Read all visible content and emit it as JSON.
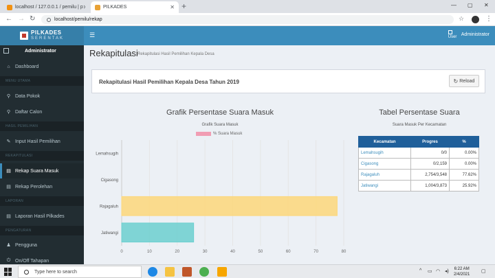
{
  "browser": {
    "tabs": [
      {
        "title": "localhost / 127.0.0.1 / pemilu | p",
        "favicon_color": "#f29111"
      },
      {
        "title": "PILKADES",
        "favicon_color": "#e8a236"
      }
    ],
    "url": "localhost/pemilu/rekap"
  },
  "app": {
    "logo_line1": "PILKADES",
    "logo_line2": "SERENTAK",
    "user_pic_alt": "User",
    "user_name": "Administrator"
  },
  "sidebar": {
    "user_name": "Administrator",
    "items": [
      {
        "type": "item",
        "label": "Dashboard",
        "icon": "home-icon",
        "glyph": "⌂"
      },
      {
        "type": "header",
        "label": "MENU UTAMA"
      },
      {
        "type": "item",
        "label": "Data Pokok",
        "icon": "map-marker-icon",
        "glyph": "⚲"
      },
      {
        "type": "item",
        "label": "Daftar Calon",
        "icon": "map-marker-icon",
        "glyph": "⚲"
      },
      {
        "type": "header",
        "label": "HASIL PEMILIHAN"
      },
      {
        "type": "item",
        "label": "Input Hasil Pemilihan",
        "icon": "edit-icon",
        "glyph": "✎"
      },
      {
        "type": "header",
        "label": "REKAPITULASI"
      },
      {
        "type": "item",
        "label": "Rekap Suara Masuk",
        "icon": "report-icon",
        "glyph": "▤",
        "active": true
      },
      {
        "type": "item",
        "label": "Rekap Perolehan",
        "icon": "report-icon",
        "glyph": "▤"
      },
      {
        "type": "header",
        "label": "LAPORAN"
      },
      {
        "type": "item",
        "label": "Laporan Hasil Pilkades",
        "icon": "report-icon",
        "glyph": "▤"
      },
      {
        "type": "header",
        "label": "PENGATURAN"
      },
      {
        "type": "item",
        "label": "Pengguna",
        "icon": "users-icon",
        "glyph": "♟"
      },
      {
        "type": "item",
        "label": "On/Off Tahapan",
        "icon": "power-icon",
        "glyph": "⏻"
      }
    ]
  },
  "page": {
    "title": "Rekapitulasi",
    "subtitle": "Rekapitulasi Hasil Pemilihan Kepala Desa",
    "box_title": "Rekapitulasi Hasil Pemilihan Kepala Desa Tahun 2019",
    "reload_label": "Reload"
  },
  "chart_section": {
    "heading": "Grafik Persentase Suara Masuk"
  },
  "chart_data": {
    "type": "bar",
    "orientation": "horizontal",
    "title": "Grafik Suara Masuk",
    "categories": [
      "Lemahsugih",
      "Cigasong",
      "Rajagaluh",
      "Jatiwangi"
    ],
    "series": [
      {
        "name": "% Suara Masuk",
        "values": [
          0,
          0,
          77.62,
          25.92
        ]
      }
    ],
    "bar_colors": [
      "#f19db3",
      "#69b3e6",
      "#fdd77a",
      "#6ccfcf"
    ],
    "xlim": [
      0,
      80
    ],
    "xticks": [
      0,
      10,
      20,
      30,
      40,
      50,
      60,
      70,
      80
    ],
    "grid": true,
    "legend": "top"
  },
  "table": {
    "heading": "Tabel Persentase Suara",
    "subheading": "Suara Masuk Per Kecamatan",
    "columns": [
      "Kecamatan",
      "Progres",
      "%"
    ],
    "rows": [
      {
        "kecamatan": "Lemahsugih",
        "progres": "0/0",
        "persen": "0.00%"
      },
      {
        "kecamatan": "Cigasong",
        "progres": "0/2,159",
        "persen": "0.00%"
      },
      {
        "kecamatan": "Rajagaluh",
        "progres": "2,754/3,548",
        "persen": "77.62%"
      },
      {
        "kecamatan": "Jatiwangi",
        "progres": "1,004/3,873",
        "persen": "25.92%"
      }
    ]
  },
  "taskbar": {
    "search_placeholder": "Type here to search",
    "time": "6:22 AM",
    "date": "2/4/2021"
  }
}
